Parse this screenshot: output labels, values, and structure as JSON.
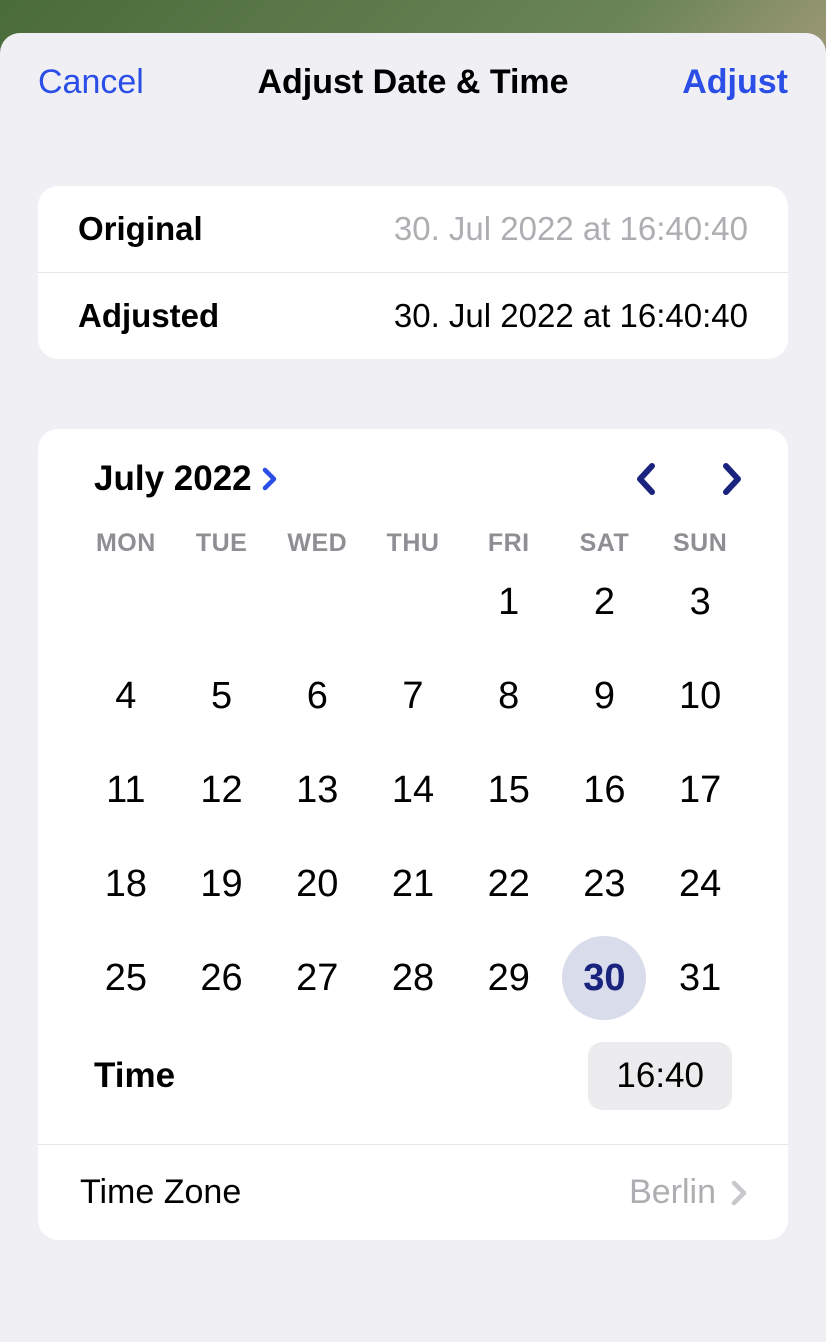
{
  "nav": {
    "cancel": "Cancel",
    "title": "Adjust Date & Time",
    "adjust": "Adjust"
  },
  "info": {
    "original_label": "Original",
    "original_value": "30. Jul 2022 at 16:40:40",
    "adjusted_label": "Adjusted",
    "adjusted_value": "30. Jul 2022 at 16:40:40"
  },
  "calendar": {
    "month_year": "July 2022",
    "weekdays": [
      "MON",
      "TUE",
      "WED",
      "THU",
      "FRI",
      "SAT",
      "SUN"
    ],
    "leading_blanks": 4,
    "days": [
      1,
      2,
      3,
      4,
      5,
      6,
      7,
      8,
      9,
      10,
      11,
      12,
      13,
      14,
      15,
      16,
      17,
      18,
      19,
      20,
      21,
      22,
      23,
      24,
      25,
      26,
      27,
      28,
      29,
      30,
      31
    ],
    "selected_day": 30
  },
  "time": {
    "label": "Time",
    "value": "16:40"
  },
  "timezone": {
    "label": "Time Zone",
    "value": "Berlin"
  },
  "colors": {
    "accent": "#2b4ee6",
    "selected_bg": "#d8dceb",
    "selected_fg": "#1a237e"
  }
}
